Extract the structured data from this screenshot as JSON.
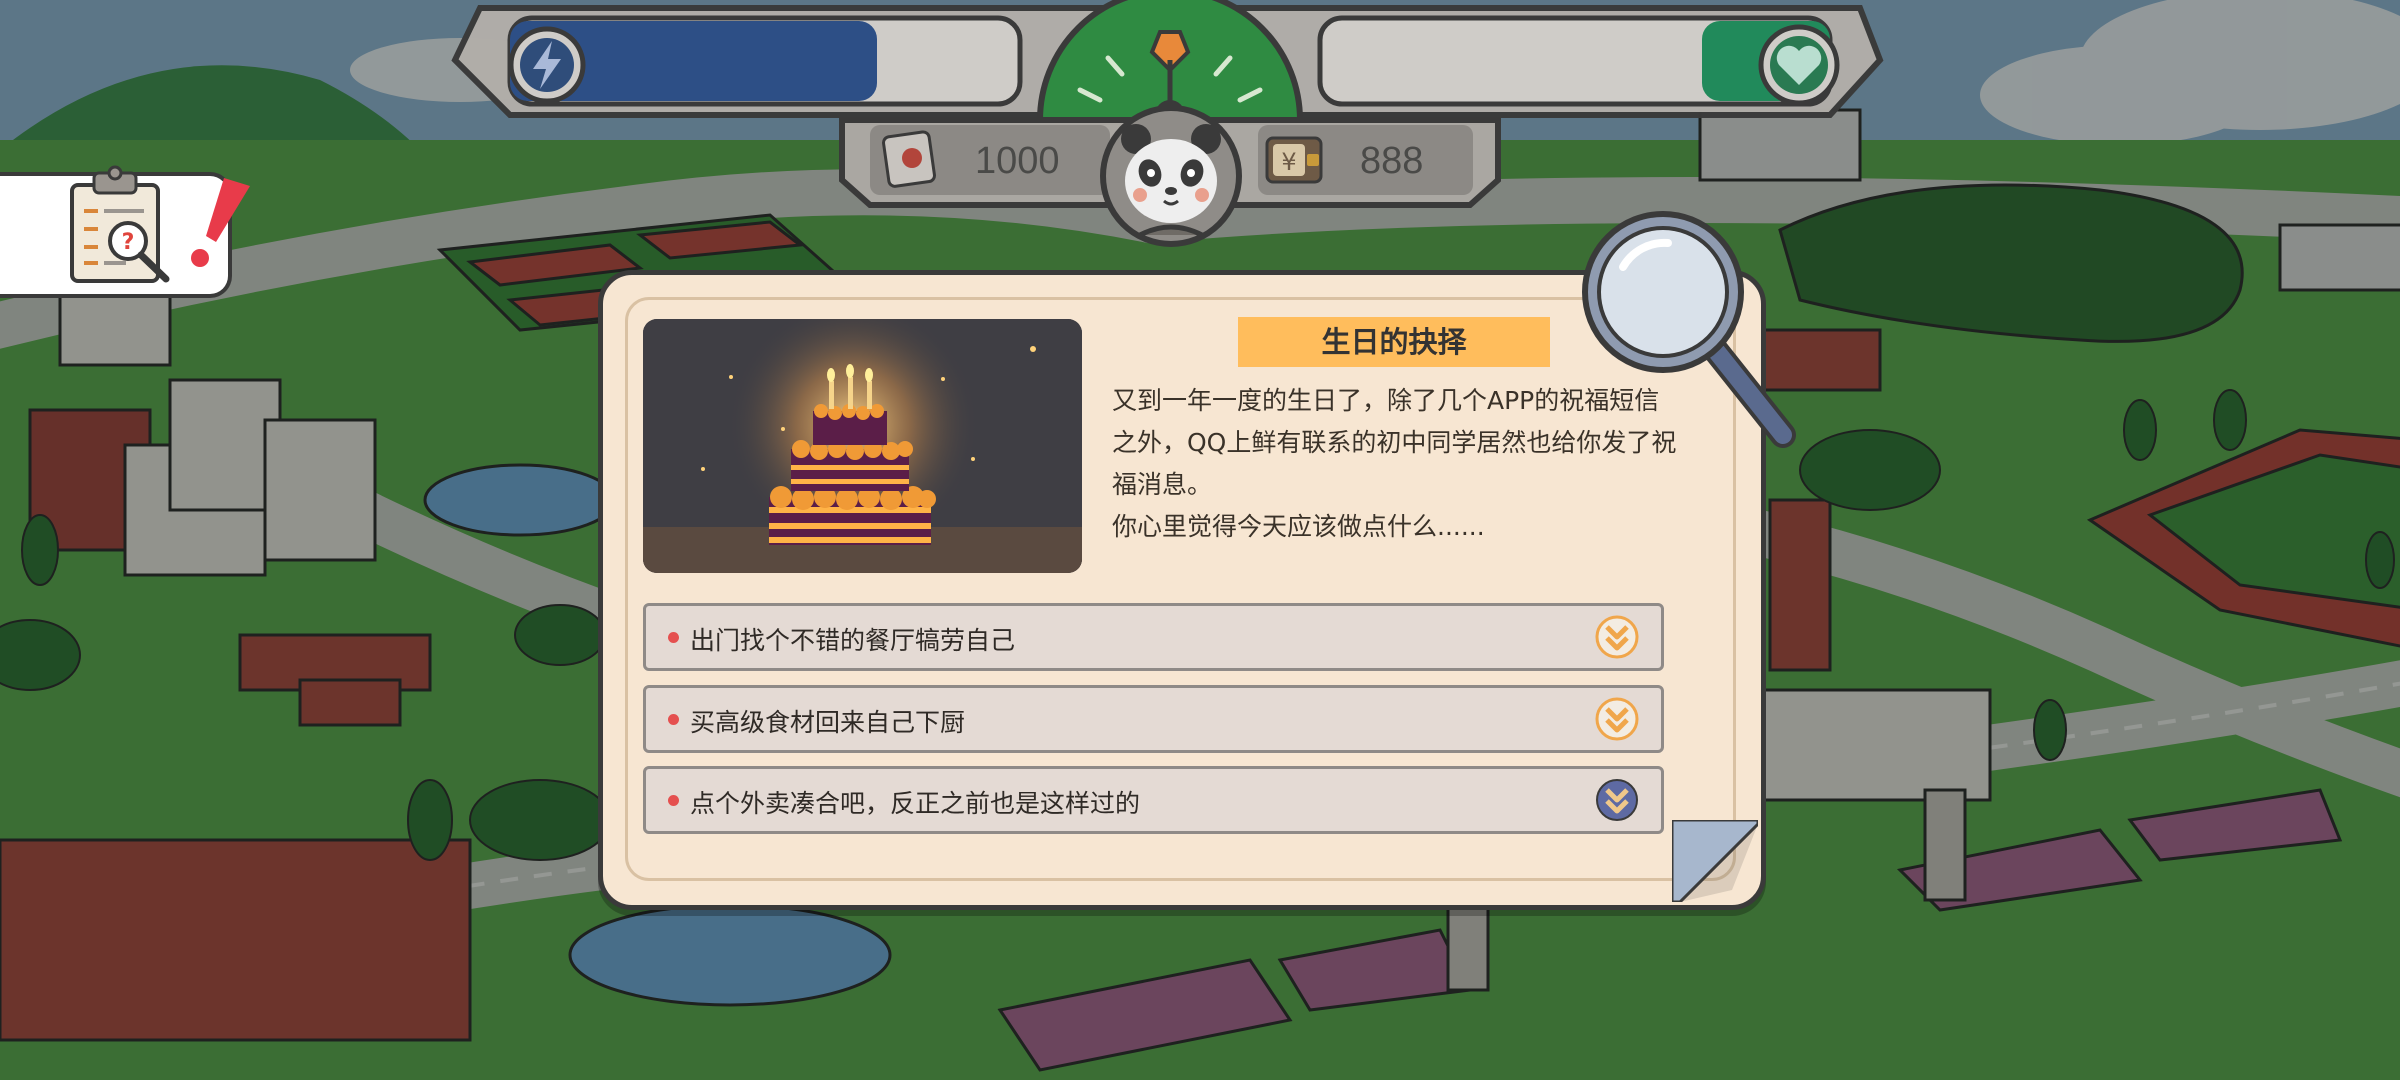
{
  "hud": {
    "energy_icon": "lightning-icon",
    "energy_level": 0.72,
    "energy_color": "#2d4f86",
    "health_icon": "heart-icon",
    "health_level": 0.25,
    "health_color": "#218a5b",
    "clock_icon": "gauge-clock-icon",
    "avatar_icon": "panda-avatar",
    "scroll_icon": "scroll-icon",
    "money_icon": "wallet-yen-icon",
    "points_value": "1000",
    "money_value": "888"
  },
  "quest_tab": {
    "icon": "clipboard-question-icon",
    "alert_icon": "exclamation-icon",
    "alert_color": "#e83b4a"
  },
  "event": {
    "title": "生日的抉择",
    "image_icon": "birthday-cake-image",
    "description": [
      "又到一年一度的生日了，除了几个APP的祝福短信",
      "之外，QQ上鲜有联系的初中同学居然也给你发了祝",
      "福消息。",
      "你心里觉得今天应该做点什么......"
    ],
    "magnifier_icon": "magnifier-icon",
    "choices": [
      {
        "label": "出门找个不错的餐厅犒劳自己",
        "chev_color": "#f0a64b"
      },
      {
        "label": "买高级食材回来自己下厨",
        "chev_color": "#f0a64b"
      },
      {
        "label": "点个外卖凑合吧，反正之前也是这样过的",
        "chev_color": "#5e6aa3"
      }
    ]
  }
}
